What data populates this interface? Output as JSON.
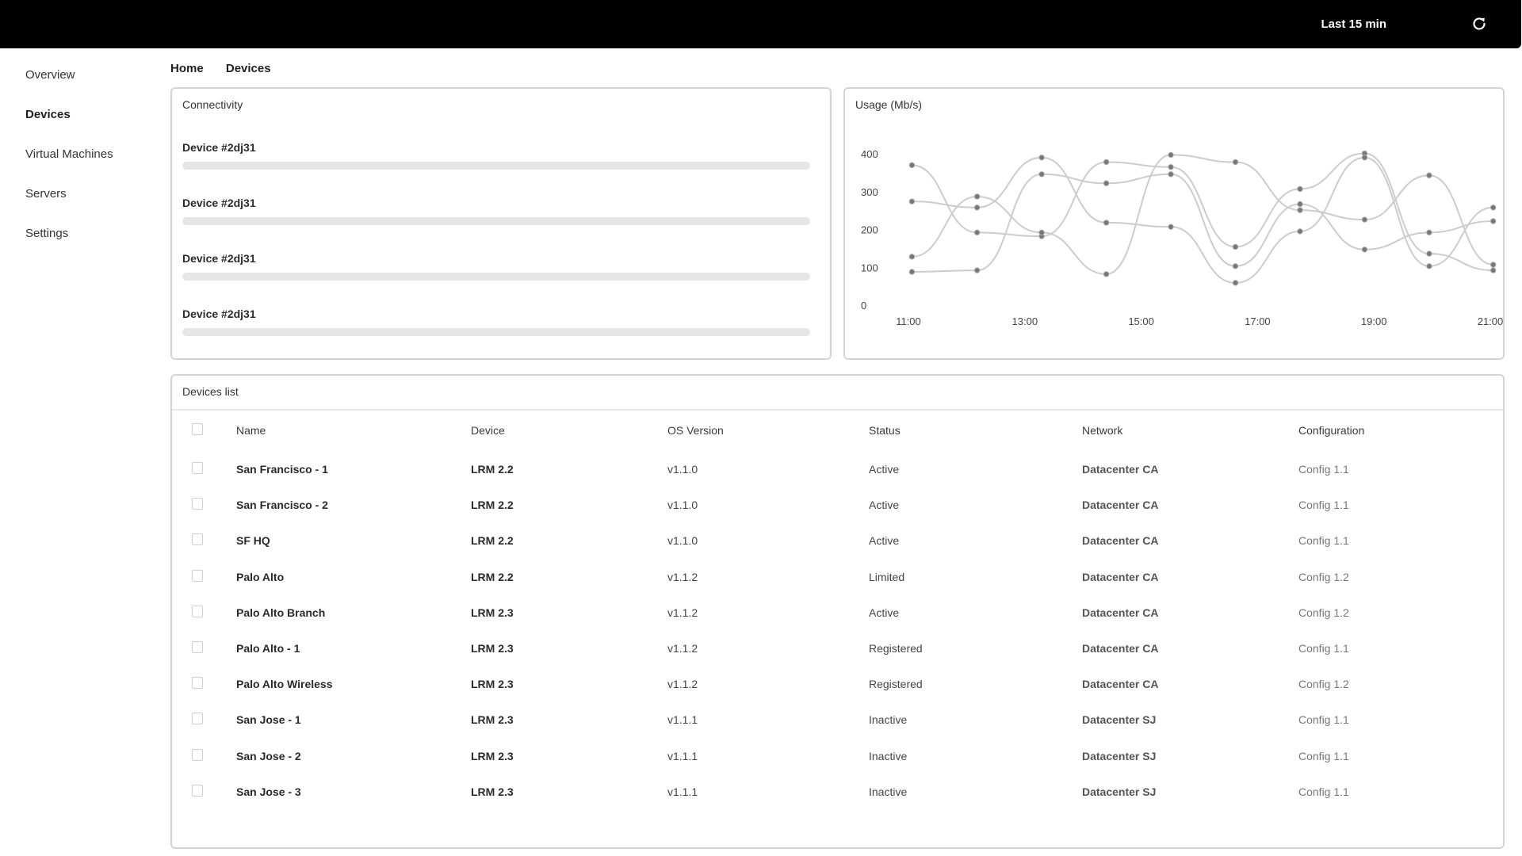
{
  "topbar": {
    "time_range": "Last 15 min",
    "refresh_icon": "refresh-icon"
  },
  "sidebar": {
    "items": [
      {
        "label": "Overview",
        "active": false
      },
      {
        "label": "Devices",
        "active": true
      },
      {
        "label": "Virtual Machines",
        "active": false
      },
      {
        "label": "Servers",
        "active": false
      },
      {
        "label": "Settings",
        "active": false
      }
    ]
  },
  "breadcrumb": [
    "Home",
    "Devices"
  ],
  "connectivity": {
    "title": "Connectivity",
    "devices": [
      {
        "label": "Device #2dj31",
        "progress": 0
      },
      {
        "label": "Device #2dj31",
        "progress": 0
      },
      {
        "label": "Device #2dj31",
        "progress": 0
      },
      {
        "label": "Device #2dj31",
        "progress": 0
      }
    ]
  },
  "chart_data": {
    "type": "line",
    "title": "Usage (Mb/s)",
    "xlabel": "",
    "ylabel": "",
    "x_tick_labels": [
      "11:00",
      "13:00",
      "15:00",
      "17:00",
      "19:00",
      "21:00"
    ],
    "x_range_hours": [
      11,
      21
    ],
    "y_ticks": [
      0,
      100,
      200,
      300,
      400
    ],
    "ylim": [
      0,
      400
    ],
    "grid": false,
    "legend": "none",
    "line_color": "#cccccc",
    "marker_color": "#777777",
    "x_points_hours": [
      11.06,
      12.18,
      13.29,
      14.4,
      15.51,
      16.62,
      17.73,
      18.84,
      19.95,
      21.05
    ],
    "series": [
      {
        "name": "series-1",
        "values": [
          370,
          192,
          182,
          378,
          365,
          154,
          307,
          401,
          136,
          92
        ]
      },
      {
        "name": "series-2",
        "values": [
          128,
          287,
          192,
          82,
          397,
          378,
          251,
          226,
          343,
          107
        ]
      },
      {
        "name": "series-3",
        "values": [
          274,
          258,
          390,
          218,
          207,
          59,
          195,
          390,
          103,
          258
        ]
      },
      {
        "name": "series-4",
        "values": [
          88,
          92,
          346,
          322,
          346,
          103,
          267,
          147,
          192,
          222
        ]
      }
    ]
  },
  "devices_list": {
    "title": "Devices list",
    "columns": [
      "Name",
      "Device",
      "OS Version",
      "Status",
      "Network",
      "Configuration"
    ],
    "rows": [
      {
        "name": "San Francisco - 1",
        "device": "LRM 2.2",
        "os": "v1.1.0",
        "status": "Active",
        "network": "Datacenter CA",
        "config": "Config 1.1"
      },
      {
        "name": "San Francisco - 2",
        "device": "LRM 2.2",
        "os": "v1.1.0",
        "status": "Active",
        "network": "Datacenter CA",
        "config": "Config 1.1"
      },
      {
        "name": "SF HQ",
        "device": "LRM 2.2",
        "os": "v1.1.0",
        "status": "Active",
        "network": "Datacenter CA",
        "config": "Config 1.1"
      },
      {
        "name": "Palo Alto",
        "device": "LRM 2.2",
        "os": "v1.1.2",
        "status": "Limited",
        "network": "Datacenter CA",
        "config": "Config 1.2"
      },
      {
        "name": "Palo Alto Branch",
        "device": "LRM 2.3",
        "os": "v1.1.2",
        "status": "Active",
        "network": "Datacenter CA",
        "config": "Config 1.2"
      },
      {
        "name": "Palo Alto - 1",
        "device": "LRM 2.3",
        "os": "v1.1.2",
        "status": "Registered",
        "network": "Datacenter CA",
        "config": "Config 1.1"
      },
      {
        "name": "Palo Alto Wireless",
        "device": "LRM 2.3",
        "os": "v1.1.2",
        "status": "Registered",
        "network": "Datacenter CA",
        "config": "Config 1.2"
      },
      {
        "name": "San Jose - 1",
        "device": "LRM 2.3",
        "os": "v1.1.1",
        "status": "Inactive",
        "network": "Datacenter SJ",
        "config": "Config 1.1"
      },
      {
        "name": "San Jose - 2",
        "device": "LRM 2.3",
        "os": "v1.1.1",
        "status": "Inactive",
        "network": "Datacenter SJ",
        "config": "Config 1.1"
      },
      {
        "name": "San Jose - 3",
        "device": "LRM 2.3",
        "os": "v1.1.1",
        "status": "Inactive",
        "network": "Datacenter SJ",
        "config": "Config 1.1"
      }
    ]
  }
}
